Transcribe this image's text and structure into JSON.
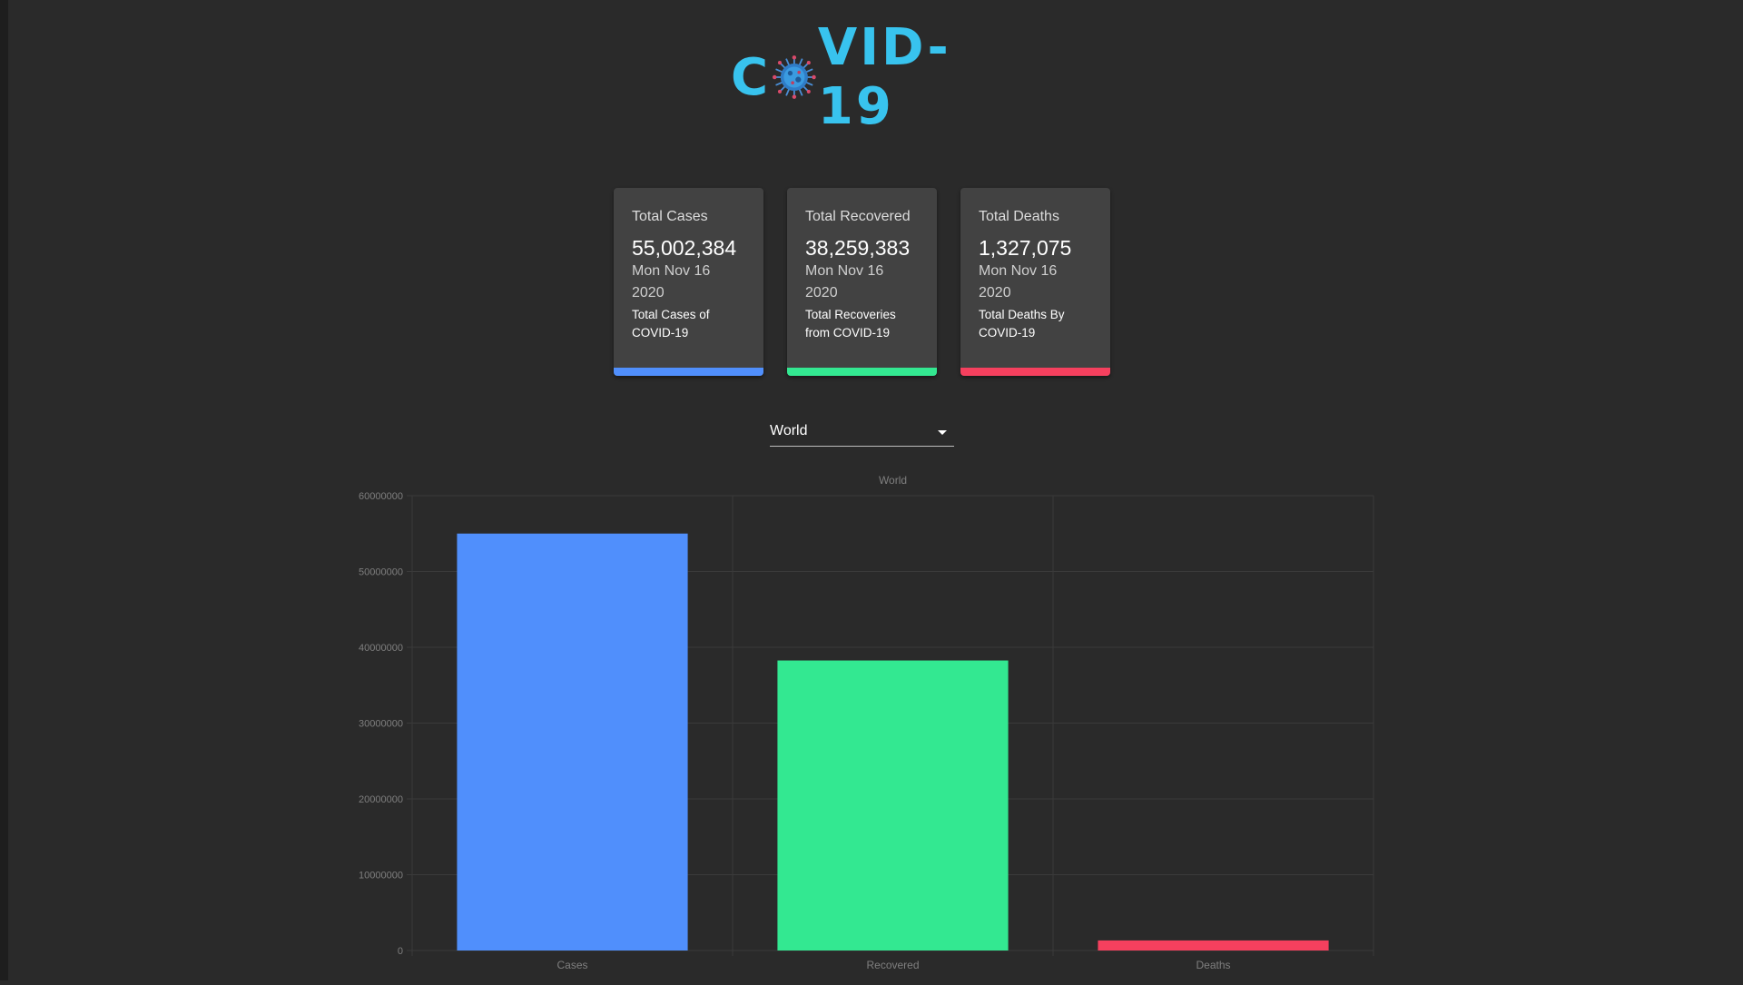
{
  "header": {
    "logo_text": "COVID-19",
    "logo_icon": "virus-icon"
  },
  "colors": {
    "background": "#2a2a2a",
    "card_background": "#424242",
    "logo": "#38c3ee",
    "cases": "#508ffc",
    "recovered": "#33e891",
    "deaths": "#f5405e",
    "grid": "#3a3a3a",
    "axis_text": "#7f7f7f"
  },
  "cards": [
    {
      "title": "Total Cases",
      "value": "55,002,384",
      "date_line1": "Mon Nov 16",
      "date_line2": "2020",
      "desc_line1": "Total Cases of",
      "desc_line2": "COVID-19",
      "color": "#508ffc"
    },
    {
      "title": "Total Recovered",
      "value": "38,259,383",
      "date_line1": "Mon Nov 16",
      "date_line2": "2020",
      "desc_line1": "Total Recoveries",
      "desc_line2": "from COVID-19",
      "color": "#33e891"
    },
    {
      "title": "Total Deaths",
      "value": "1,327,075",
      "date_line1": "Mon Nov 16",
      "date_line2": "2020",
      "desc_line1": "Total Deaths By",
      "desc_line2": "COVID-19",
      "color": "#f5405e"
    }
  ],
  "country_select": {
    "selected": "World"
  },
  "chart_data": {
    "type": "bar",
    "title": "World",
    "categories": [
      "Cases",
      "Recovered",
      "Deaths"
    ],
    "values": [
      55002384,
      38259383,
      1327075
    ],
    "colors": [
      "#508ffc",
      "#33e891",
      "#f5405e"
    ],
    "ylim": [
      0,
      60000000
    ],
    "yticks": [
      0,
      10000000,
      20000000,
      30000000,
      40000000,
      50000000,
      60000000
    ],
    "xlabel": "",
    "ylabel": "",
    "grid": true,
    "legend": "none"
  }
}
